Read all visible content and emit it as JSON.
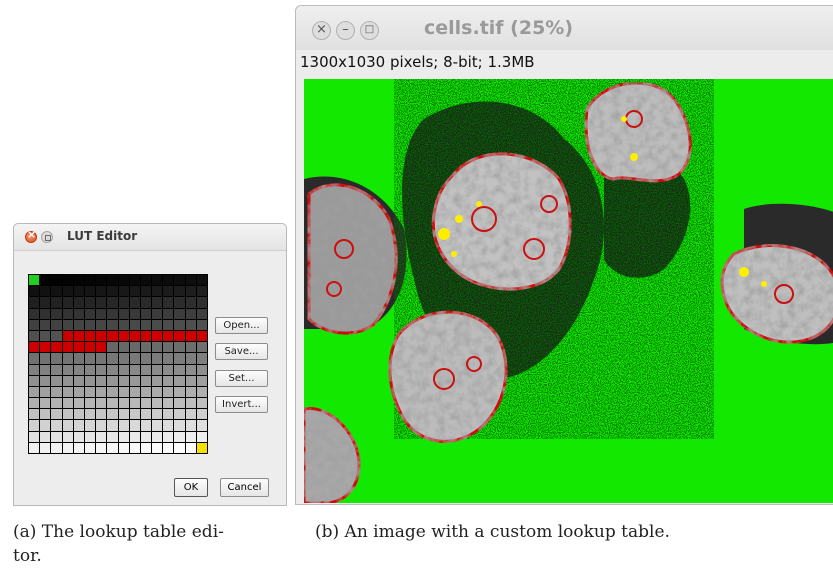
{
  "lut_editor": {
    "title": "LUT Editor",
    "buttons": {
      "open": "Open...",
      "save": "Save...",
      "set": "Set...",
      "invert": "Invert..."
    },
    "ok_label": "OK",
    "cancel_label": "Cancel",
    "colors": {
      "first_entry": "#20d020",
      "highlight": "#cc0000",
      "last_entry": "#f5e000"
    }
  },
  "image_window": {
    "title": "cells.tif (25%)",
    "info": "1300x1030 pixels; 8-bit; 1.3MB",
    "colors": {
      "background": "#12e800",
      "edge": "#cc1010",
      "bright": "#ffee00"
    }
  },
  "captions": {
    "a": "(a) The lookup table edi-",
    "a_cont": "tor.",
    "b": "(b) An image with a custom lookup table."
  }
}
